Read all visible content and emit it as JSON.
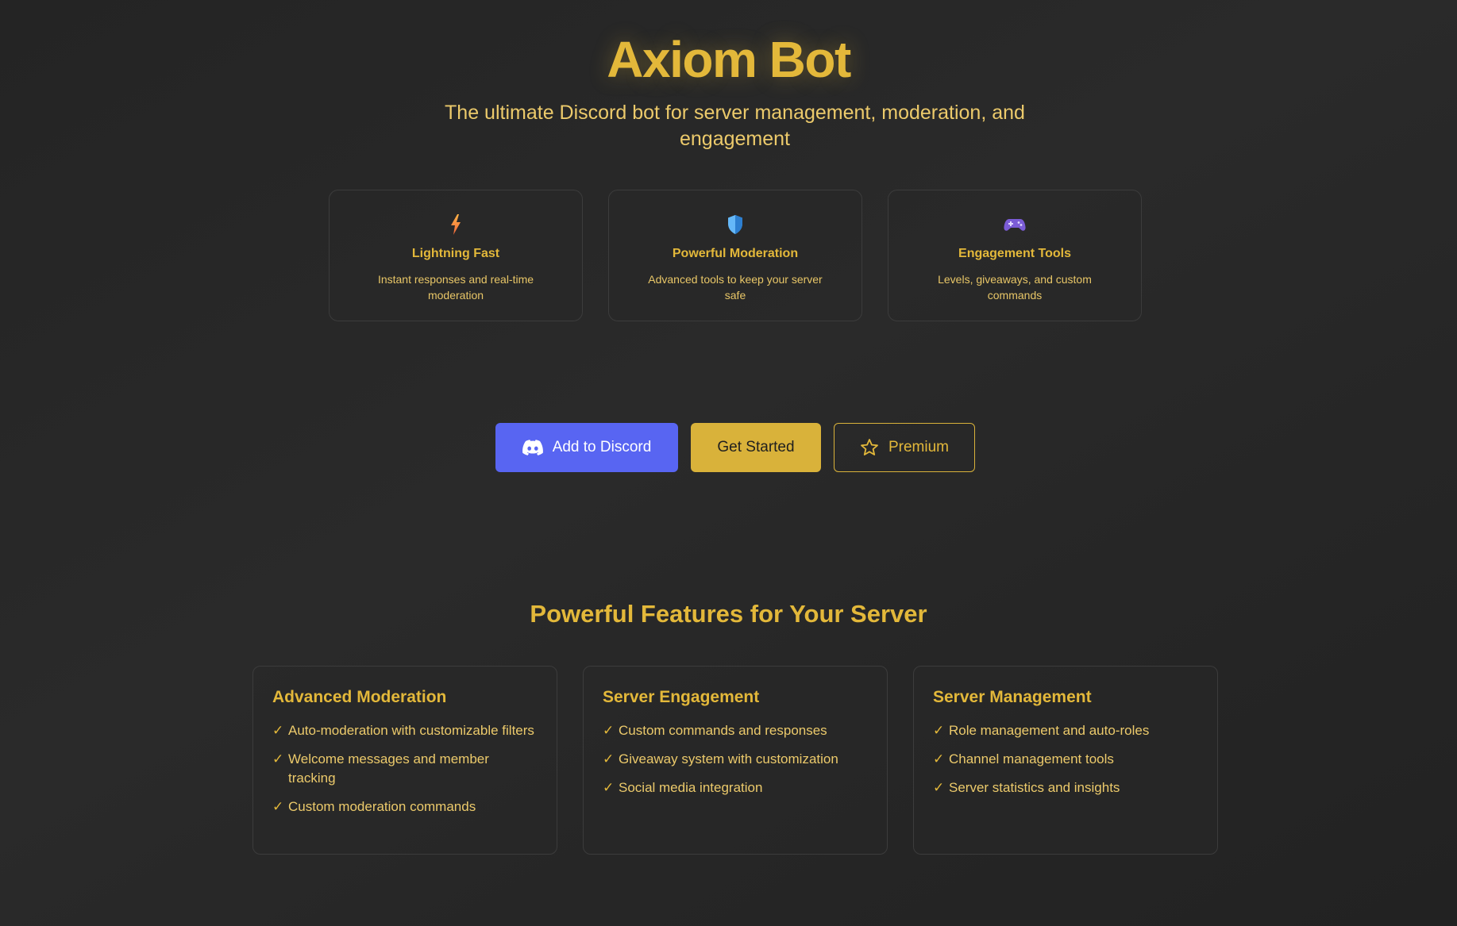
{
  "hero": {
    "title": "Axiom Bot",
    "subtitle": "The ultimate Discord bot for server management, moderation, and engagement"
  },
  "highlights": [
    {
      "icon": "lightning-icon",
      "title": "Lightning Fast",
      "desc": "Instant responses and real-time moderation"
    },
    {
      "icon": "shield-icon",
      "title": "Powerful Moderation",
      "desc": "Advanced tools to keep your server safe"
    },
    {
      "icon": "gamepad-icon",
      "title": "Engagement Tools",
      "desc": "Levels, giveaways, and custom commands"
    }
  ],
  "actions": {
    "discord_label": "Add to Discord",
    "started_label": "Get Started",
    "premium_label": "Premium"
  },
  "features": {
    "title": "Powerful Features for Your Server",
    "cards": [
      {
        "title": "Advanced Moderation",
        "items": [
          "Auto-moderation with customizable filters",
          "Welcome messages and member tracking",
          "Custom moderation commands"
        ]
      },
      {
        "title": "Server Engagement",
        "items": [
          "Custom commands and responses",
          "Giveaway system with customization",
          "Social media integration"
        ]
      },
      {
        "title": "Server Management",
        "items": [
          "Role management and auto-roles",
          "Channel management tools",
          "Server statistics and insights"
        ]
      }
    ]
  },
  "check_glyph": "✓",
  "colors": {
    "accent": "#e3b83a",
    "discord": "#5865f2",
    "background": "#262626"
  }
}
